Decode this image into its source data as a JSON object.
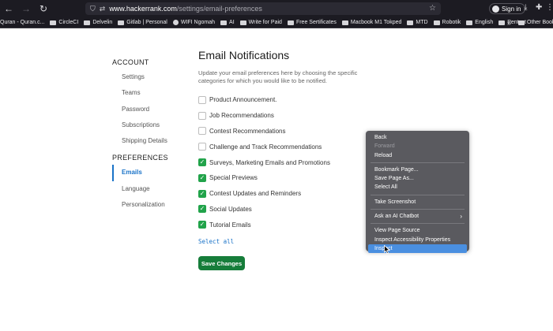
{
  "browser": {
    "url_domain": "www.hackerrank.com",
    "url_path": "/settings/email-preferences",
    "signin_label": "Sign in",
    "icons": [
      "back-icon",
      "forward-icon",
      "reload-icon",
      "shield-icon",
      "tune-icon",
      "star-icon",
      "user-icon",
      "download-icon",
      "extensions-icon",
      "menu-icon"
    ]
  },
  "bookmarks": {
    "items": [
      {
        "label": "Quran - Quran.c..."
      },
      {
        "label": "CircleCI"
      },
      {
        "label": "Delvelin"
      },
      {
        "label": "Gitlab | Personal"
      },
      {
        "label": "WIFI Ngomah"
      },
      {
        "label": "AI"
      },
      {
        "label": "Write for Paid"
      },
      {
        "label": "Free Sertificates"
      },
      {
        "label": "Macbook M1 Tokped"
      },
      {
        "label": "MTD"
      },
      {
        "label": "Robotik"
      },
      {
        "label": "English"
      },
      {
        "label": "Pentest"
      }
    ],
    "overflow_label": "»",
    "other_label": "Other Bookm"
  },
  "sidebar": {
    "account_heading": "ACCOUNT",
    "account_items": [
      {
        "label": "Settings"
      },
      {
        "label": "Teams"
      },
      {
        "label": "Password"
      },
      {
        "label": "Subscriptions"
      },
      {
        "label": "Shipping Details"
      }
    ],
    "preferences_heading": "PREFERENCES",
    "preferences_items": [
      {
        "label": "Emails",
        "active": true
      },
      {
        "label": "Language"
      },
      {
        "label": "Personalization"
      }
    ]
  },
  "main": {
    "title": "Email Notifications",
    "description": "Update your email preferences here by choosing the specific categories for which you would like to be notified.",
    "options": [
      {
        "label": "Product Announcement.",
        "checked": false
      },
      {
        "label": "Job Recommendations",
        "checked": false
      },
      {
        "label": "Contest Recommendations",
        "checked": false
      },
      {
        "label": "Challenge and Track Recommendations",
        "checked": false
      },
      {
        "label": "Surveys, Marketing Emails and Promotions",
        "checked": true
      },
      {
        "label": "Special Previews",
        "checked": true
      },
      {
        "label": "Contest Updates and Reminders",
        "checked": true
      },
      {
        "label": "Social Updates",
        "checked": true
      },
      {
        "label": "Tutorial Emails",
        "checked": true
      }
    ],
    "select_all_label": "Select all",
    "save_label": "Save Changes",
    "accent_color": "#167d3a"
  },
  "context_menu": {
    "groups": [
      [
        {
          "label": "Back"
        },
        {
          "label": "Forward",
          "disabled": true
        },
        {
          "label": "Reload"
        }
      ],
      [
        {
          "label": "Bookmark Page..."
        },
        {
          "label": "Save Page As..."
        },
        {
          "label": "Select All"
        }
      ],
      [
        {
          "label": "Take Screenshot"
        }
      ],
      [
        {
          "label": "Ask an AI Chatbot",
          "submenu": true
        }
      ],
      [
        {
          "label": "View Page Source"
        },
        {
          "label": "Inspect Accessibility Properties"
        },
        {
          "label": "Inspect",
          "highlighted": true
        }
      ]
    ]
  }
}
